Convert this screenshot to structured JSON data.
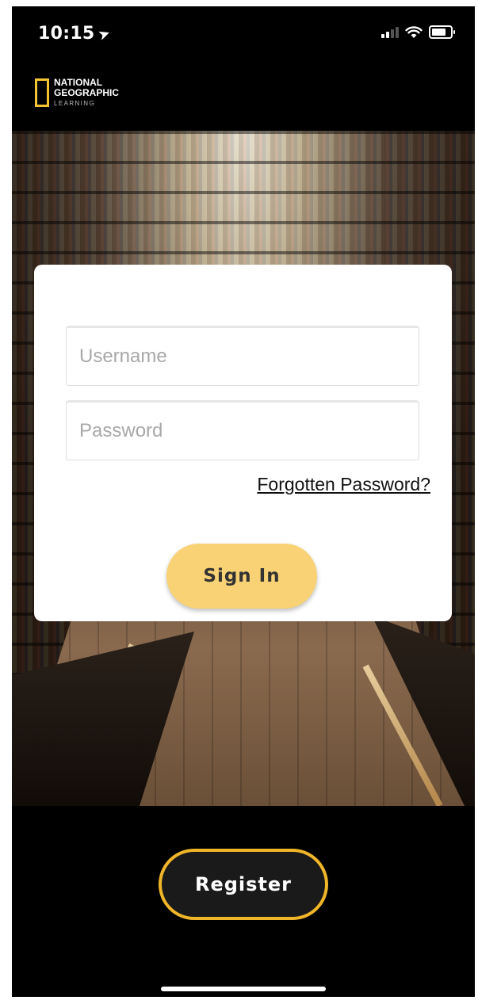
{
  "status_bar": {
    "time": "10:15",
    "location_glyph": "➤"
  },
  "logo": {
    "line1": "NATIONAL",
    "line2": "GEOGRAPHIC",
    "line3": "LEARNING",
    "accent_color": "#f4c430"
  },
  "login": {
    "username_placeholder": "Username",
    "password_placeholder": "Password",
    "forgot_label": "Forgotten Password?",
    "sign_in_label": "Sign In"
  },
  "register_label": "Register",
  "colors": {
    "sign_in_button": "#f8d274",
    "register_border": "#f0b528",
    "background": "#000000"
  }
}
